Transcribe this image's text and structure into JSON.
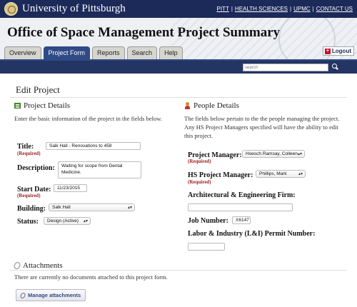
{
  "header": {
    "university": "University of Pittsburgh",
    "links": [
      "PITT",
      "HEALTH SCIENCES",
      "UPMC",
      "CONTACT US"
    ]
  },
  "banner": {
    "title": "Office of Space Management Project Summary",
    "tabs": [
      {
        "label": "Overview",
        "active": false
      },
      {
        "label": "Project Form",
        "active": true
      },
      {
        "label": "Reports",
        "active": false
      },
      {
        "label": "Search",
        "active": false
      },
      {
        "label": "Help",
        "active": false
      }
    ],
    "logout": "Logout"
  },
  "search": {
    "placeholder": "search"
  },
  "page": {
    "title": "Edit Project"
  },
  "project_details": {
    "heading": "Project Details",
    "description": "Enter the basic information of the project in the fields below.",
    "title_label": "Title:",
    "title_value": "Salk Hall - Renovations to 458",
    "description_label": "Description:",
    "description_value": "Waiting for scope from Dental Medicine.",
    "start_date_label": "Start Date:",
    "start_date_value": "11/23/2015",
    "building_label": "Building:",
    "building_value": "Salk Hall",
    "status_label": "Status:",
    "status_value": "Design (Active)",
    "required": "(Required)"
  },
  "people_details": {
    "heading": "People Details",
    "description": "The fields below pertain to the the people managing the project. Any HS Project Managers specified will have the ability to edit this project.",
    "pm_label": "Project Manager:",
    "pm_value": "Hoesch Ramsay, Colleen",
    "hs_pm_label": "HS Project Manager:",
    "hs_pm_value": "Phillips, Mark",
    "ae_label": "Architectural & Engineering Firm:",
    "ae_value": "",
    "job_label": "Job Number:",
    "job_value": "X6147",
    "permit_label": "Labor & Industry (L&I) Permit Number:",
    "permit_value": "",
    "required": "(Required)"
  },
  "attachments": {
    "heading": "Attachments",
    "text": "There are currently no documents attached to this project form.",
    "button": "Manage attachments"
  }
}
